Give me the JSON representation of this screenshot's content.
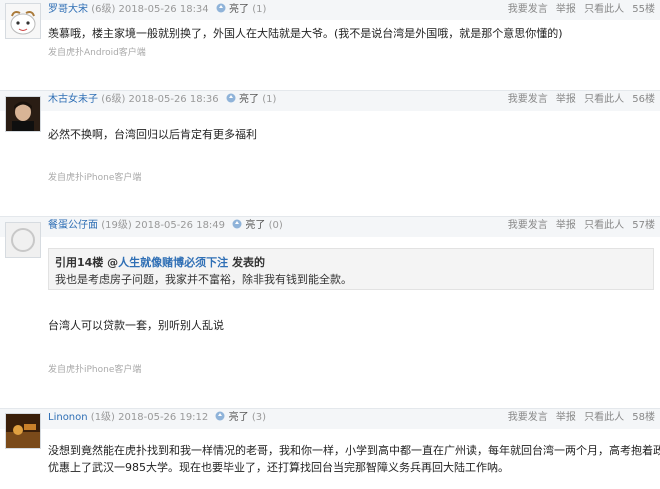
{
  "actions": {
    "report_spam": "我要发言",
    "report": "举报",
    "only_this_user": "只看此人"
  },
  "posts": [
    {
      "username": "罗哥大宋",
      "level": "(6级)",
      "time": "2018-05-26 18:34",
      "light_label": "亮了",
      "light_count": "(1)",
      "floor": "55楼",
      "content": "羡慕哦，楼主家境一般就别换了，外国人在大陆就是大爷。(我不是说台湾是外国哦，就是那个意思你懂的)",
      "client": "发自虎扑Android客户端"
    },
    {
      "username": "木古女未子",
      "level": "(6级)",
      "time": "2018-05-26 18:36",
      "light_label": "亮了",
      "light_count": "(1)",
      "floor": "56楼",
      "content": "必然不换啊，台湾回归以后肯定有更多福利",
      "client": "发自虎扑iPhone客户端"
    },
    {
      "username": "餐蛋公仔面",
      "level": "(19级)",
      "time": "2018-05-26 18:49",
      "light_label": "亮了",
      "light_count": "(0)",
      "floor": "57楼",
      "quote": {
        "prefix": "引用14楼 @",
        "user": "人生就像赌博必须下注",
        "suffix": " 发表的",
        "text": "我也是考虑房子问题，我家并不富裕，除非我有钱到能全款。"
      },
      "content": "台湾人可以贷款一套，别听别人乱说",
      "client": "发自虎扑iPhone客户端"
    },
    {
      "username": "Linonon",
      "level": "(1级)",
      "time": "2018-05-26 19:12",
      "light_label": "亮了",
      "light_count": "(3)",
      "floor": "58楼",
      "content_line1": "没想到竟然能在虎扑找到和我一样情况的老哥，我和你一样，小学到高中都一直在广州读，每年就回台湾一两个月，高考抱着政策",
      "content_line2": "优惠上了武汉一985大学。现在也要毕业了，还打算找回台当完那智障义务兵再回大陆工作呐。"
    }
  ]
}
